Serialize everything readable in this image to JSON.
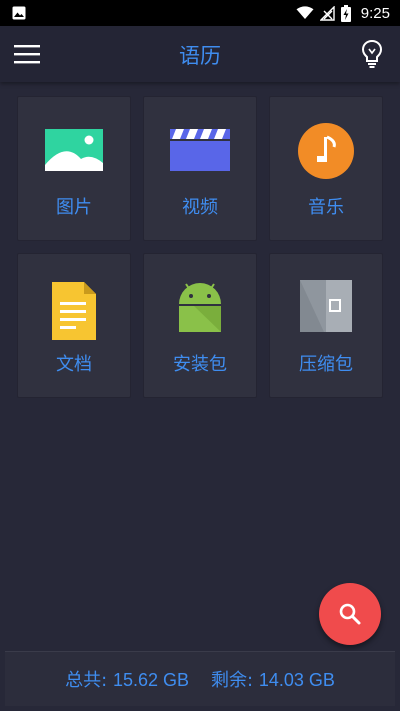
{
  "status_bar": {
    "time": "9:25"
  },
  "app_bar": {
    "title": "语历"
  },
  "categories": [
    {
      "label": "图片",
      "icon": "image-icon"
    },
    {
      "label": "视频",
      "icon": "video-clapper-icon"
    },
    {
      "label": "音乐",
      "icon": "music-note-icon"
    },
    {
      "label": "文档",
      "icon": "document-icon"
    },
    {
      "label": "安装包",
      "icon": "android-icon"
    },
    {
      "label": "压缩包",
      "icon": "archive-icon"
    }
  ],
  "storage": {
    "total_label": "总共:",
    "total_value": "15.62 GB",
    "free_label": "剩余:",
    "free_value": "14.03 GB"
  },
  "colors": {
    "accent": "#3f8df0",
    "background": "#272838",
    "tile": "#30313f",
    "fab": "#f04b4c"
  }
}
